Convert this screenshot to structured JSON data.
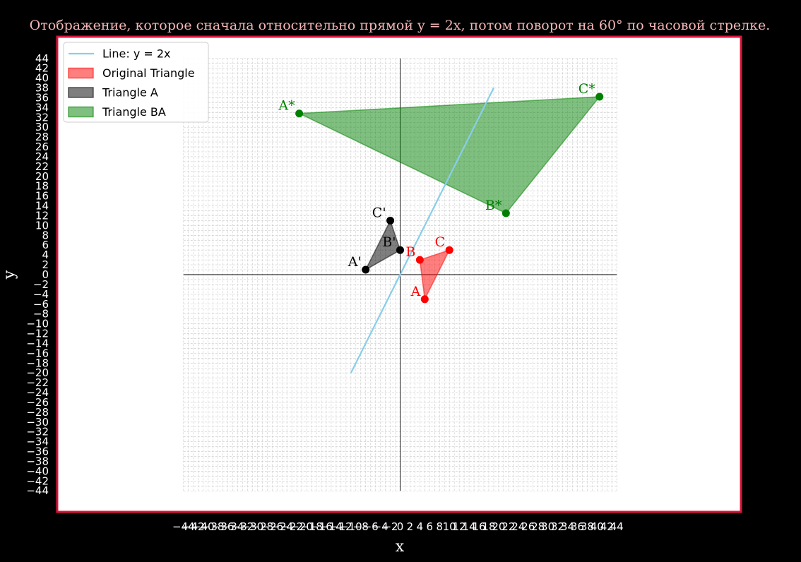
{
  "chart_data": {
    "type": "scatter",
    "title": "Отображение, которое сначала относительно прямой  y = 2x, потом поворот на 60° по часовой стрелке.",
    "xlabel": "x",
    "ylabel": "y",
    "xlim": [
      -44,
      44
    ],
    "ylim": [
      -44,
      44
    ],
    "grid": true,
    "legend_position": "top-left",
    "ticks": [
      -44,
      -42,
      -40,
      -38,
      -36,
      -34,
      -32,
      -30,
      -28,
      -26,
      -24,
      -22,
      -20,
      -18,
      -16,
      -14,
      -12,
      -10,
      -8,
      -6,
      -4,
      -2,
      0,
      2,
      4,
      6,
      8,
      10,
      12,
      14,
      16,
      18,
      20,
      22,
      24,
      26,
      28,
      30,
      32,
      34,
      36,
      38,
      40,
      42,
      44
    ],
    "line": {
      "name": "Line: y = 2x",
      "color": "#87ceeb",
      "points": [
        [
          -10,
          -20
        ],
        [
          19,
          38
        ]
      ]
    },
    "triangles": [
      {
        "name": "Original Triangle",
        "color": "#ff0000",
        "points": [
          {
            "label": "A",
            "x": 5,
            "y": -5
          },
          {
            "label": "B",
            "x": 4,
            "y": 3
          },
          {
            "label": "C",
            "x": 10,
            "y": 5
          }
        ]
      },
      {
        "name": "Triangle A",
        "color": "#000000",
        "points": [
          {
            "label": "A'",
            "x": -7,
            "y": 1
          },
          {
            "label": "B'",
            "x": 0,
            "y": 5
          },
          {
            "label": "C'",
            "x": -2,
            "y": 11
          }
        ]
      },
      {
        "name": "Triangle BA",
        "color": "#008000",
        "points": [
          {
            "label": "A*",
            "x": -20.5,
            "y": 32.8
          },
          {
            "label": "B*",
            "x": 21.5,
            "y": 12.5
          },
          {
            "label": "C*",
            "x": 40.5,
            "y": 36.2
          }
        ]
      }
    ]
  }
}
